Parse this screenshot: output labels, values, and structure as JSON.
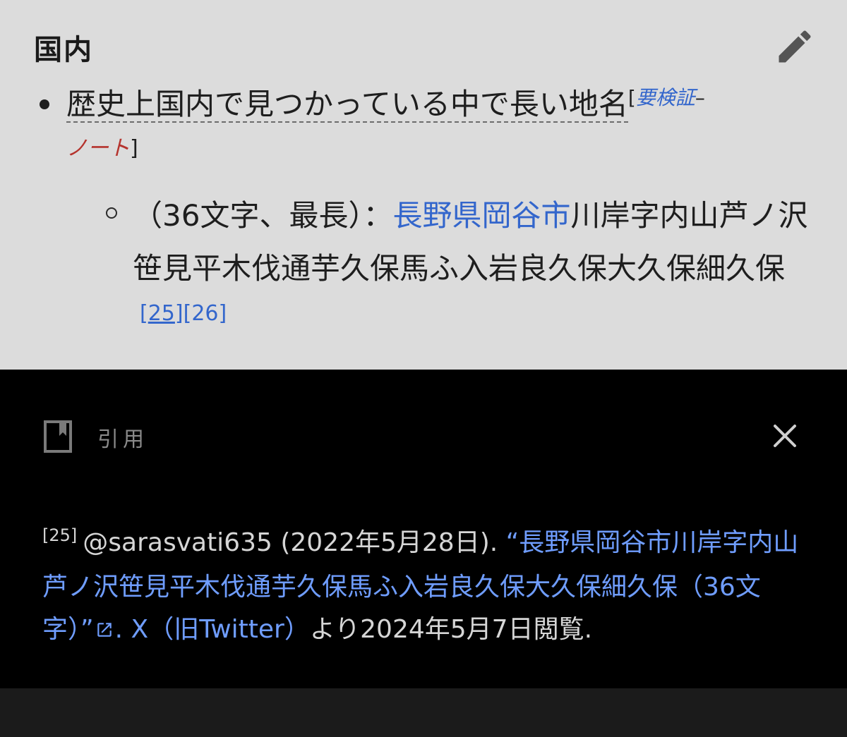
{
  "article": {
    "heading": "国内",
    "bullet_text": "歴史上国内で見つかっている中で長い地名",
    "verify_open": "[",
    "verify_label": "要検証",
    "verify_sep": "–",
    "note_label": "ノート",
    "verify_close": "]",
    "sub_prefix": "（36文字、最長）：",
    "sub_link": "長野県岡谷市",
    "sub_rest": "川岸字内山芦ノ沢笹見平木伐通芋久保馬ふ入岩良久保大久保細久保",
    "ref_open": "[",
    "ref_25": "25",
    "ref_mid": "][",
    "ref_26": "26",
    "ref_close": "]"
  },
  "citation_panel": {
    "title": "引用",
    "number": "[25]",
    "author": "@sarasvati635 (2022年5月28日). ",
    "link_title": "“長野県岡谷市川岸字内山芦ノ沢笹見平木伐通芋久保馬ふ入岩良久保大久保細久保（36文字）”",
    "publisher": ". X（旧Twitter）",
    "accessed": "より2024年5月7日閲覧."
  },
  "icons": {
    "edit": "pencil-icon",
    "citation": "bookmark-icon",
    "close": "close-icon",
    "external": "external-link-icon"
  },
  "colors": {
    "link": "#3366cc",
    "link_missing": "#b5332d",
    "dark_link": "#6f9dff",
    "article_bg": "#dcdcdc",
    "panel_bg": "#000000"
  }
}
